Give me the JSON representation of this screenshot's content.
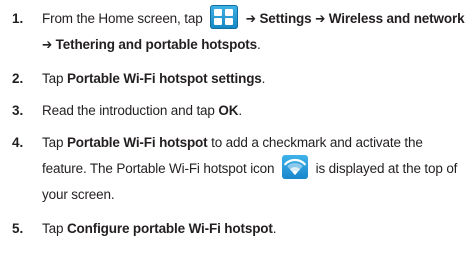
{
  "steps": [
    {
      "number": "1.",
      "pre": "From the Home screen, tap",
      "icon_after_pre": "apps-grid-icon",
      "arrow1": "➔",
      "b1": "Settings",
      "arrow2": "➔",
      "b2": "Wireless and network",
      "arrow3": "➔",
      "b3": "Tethering and portable hotspots",
      "post": "."
    },
    {
      "number": "2.",
      "pre": "Tap",
      "b1": "Portable Wi-Fi hotspot settings",
      "post": "."
    },
    {
      "number": "3.",
      "pre": "Read the introduction and tap",
      "b1": "OK",
      "post": "."
    },
    {
      "number": "4.",
      "pre": "Tap",
      "b1": "Portable Wi-Fi hotspot",
      "mid": "to add a checkmark and activate the feature. The Portable Wi-Fi hotspot icon",
      "icon_after_mid": "wifi-hotspot-icon",
      "post": "is displayed at the top of your screen."
    },
    {
      "number": "5.",
      "pre": "Tap",
      "b1": "Configure portable Wi-Fi hotspot",
      "post": "."
    }
  ],
  "colors": {
    "text": "#231f20",
    "icon_blue": "#1a86cc"
  }
}
